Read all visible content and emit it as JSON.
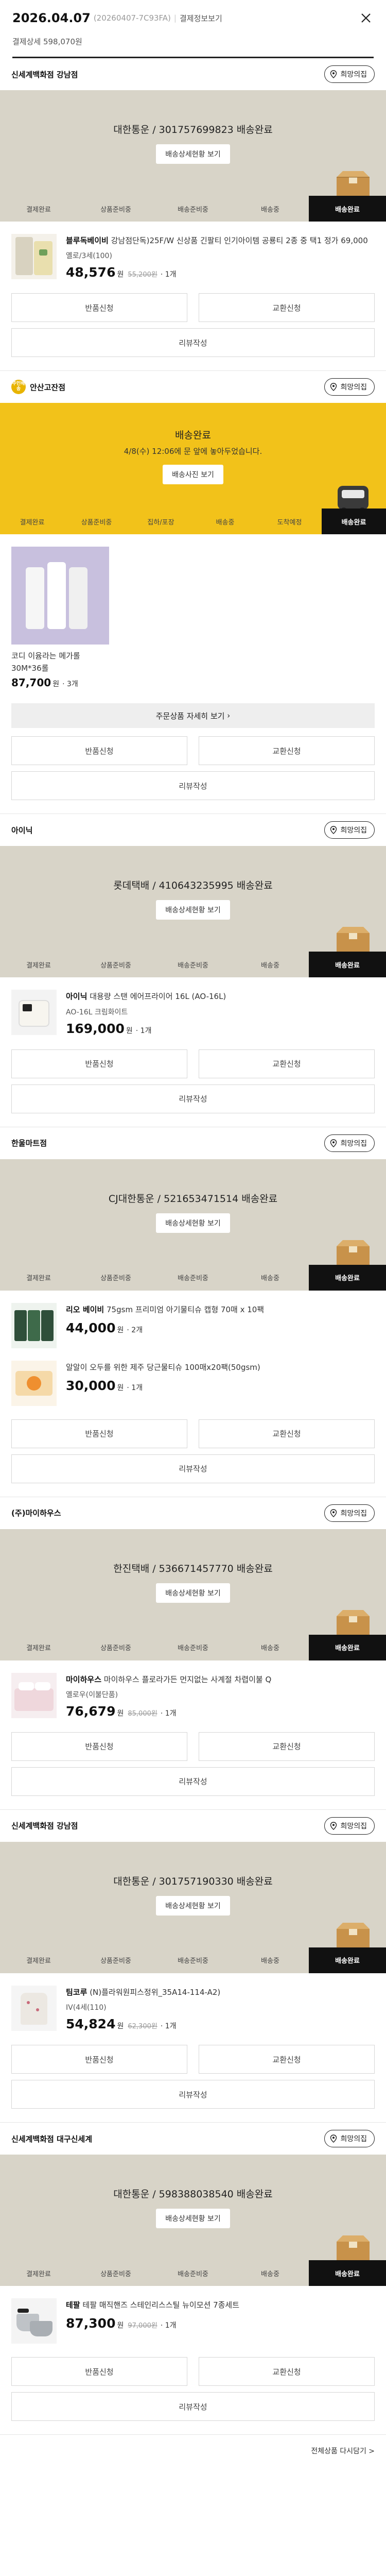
{
  "header": {
    "date": "2026.04.07",
    "order_no": "(20260407-7C93FA)",
    "view_label": "결제정보보기",
    "total_label": "결제상세 598,070원"
  },
  "hope_label": "희망의집",
  "steps_common": [
    "결제완료",
    "상품준비중",
    "배송준비중",
    "배송중",
    "배송완료"
  ],
  "steps_long": [
    "결제완료",
    "상품준비중",
    "집하/포장",
    "배송중",
    "도착예정",
    "배송완료"
  ],
  "detail_button": "배송상세현황 보기",
  "buttons": {
    "return": "반품신청",
    "exchange": "교환신청",
    "review": "리뷰작성"
  },
  "sections": [
    {
      "store": "신세계백화점 강남점",
      "carrier": "대한통운 / 301757699823 배송완료",
      "item": {
        "brand": "블루독베이비",
        "name": "강남점단독)25F/W 신상품 긴팔티 인기아이템 공룡티 2종 중 택1 정가 69,000",
        "option": "옐로/3세(100)",
        "price": "48,576",
        "orig": "55,200원",
        "qty": "1개"
      }
    },
    {
      "store": "안산고잔점",
      "store_badge": "주인배송",
      "status": "배송완료",
      "note": "4/8(수) 12:06에 문 앞에 놓아두었습니다.",
      "detail_label": "배송사진 보기",
      "item": {
        "name": "코디 이윰라는 메가롤 30M*36롤",
        "price": "87,700",
        "qty": "3개"
      },
      "more_label": "주문상품 자세히 보기"
    },
    {
      "store": "아이닉",
      "carrier": "롯데택배 / 410643235995 배송완료",
      "item": {
        "brand": "아이닉",
        "name": "대용량 스탠 에어프라이어 16L (AO-16L)",
        "option": "AO-16L 크림화이트",
        "price": "169,000",
        "qty": "1개"
      }
    },
    {
      "store": "한울마트점",
      "carrier": "CJ대한통운 / 521653471514 배송완료",
      "items": [
        {
          "brand": "리오 베이비",
          "name": "75gsm 프리미엄 아기물티슈 캡형 70매 x 10팩",
          "price": "44,000",
          "qty": "2개"
        },
        {
          "name": "알알이 오두를 위한 제주 당근물티슈 100매x20팩(50gsm)",
          "price": "30,000",
          "qty": "1개"
        }
      ]
    },
    {
      "store": "(주)마이하우스",
      "carrier": "한진택배 / 536671457770 배송완료",
      "item": {
        "brand": "마이하우스",
        "name": "마이하우스 플로라가든 먼지없는 사계절 차렵이불 Q",
        "option": "옐로우(이불단품)",
        "price": "76,679",
        "orig": "85,000원",
        "qty": "1개"
      }
    },
    {
      "store": "신세계백화점 강남점",
      "carrier": "대한통운 / 301757190330 배송완료",
      "item": {
        "brand": "팀코루",
        "name": "(N)플라워원피스정위_35A14-114-A2)",
        "option": "IV(4세(110)",
        "price": "54,824",
        "orig": "62,300원",
        "qty": "1개"
      }
    },
    {
      "store": "신세계백화점 대구신세계",
      "carrier": "대한통운 / 598388038540 배송완료",
      "item": {
        "brand": "테팔",
        "name": "테팔 매직핸즈 스테인리스스틸 뉴이모션 7종세트",
        "price": "87,300",
        "orig": "97,000원",
        "qty": "1개"
      }
    }
  ],
  "bottom_link": "전체상품 다시담기 >",
  "colors": {
    "beige": "#d8d4c8",
    "yellow": "#f2c21a",
    "active": "#111111"
  }
}
